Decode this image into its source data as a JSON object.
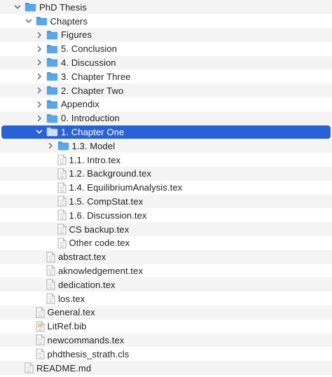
{
  "rows": [
    {
      "label": "PhD Thesis",
      "depth": 0,
      "type": "folder",
      "expander": "expanded",
      "selected": false
    },
    {
      "label": "Chapters",
      "depth": 1,
      "type": "folder",
      "expander": "expanded",
      "selected": false
    },
    {
      "label": "Figures",
      "depth": 2,
      "type": "folder",
      "expander": "collapsed",
      "selected": false
    },
    {
      "label": "5. Conclusion",
      "depth": 2,
      "type": "folder",
      "expander": "collapsed",
      "selected": false
    },
    {
      "label": "4. Discussion",
      "depth": 2,
      "type": "folder",
      "expander": "collapsed",
      "selected": false
    },
    {
      "label": "3. Chapter Three",
      "depth": 2,
      "type": "folder",
      "expander": "collapsed",
      "selected": false
    },
    {
      "label": "2. Chapter Two",
      "depth": 2,
      "type": "folder",
      "expander": "collapsed",
      "selected": false
    },
    {
      "label": "Appendix",
      "depth": 2,
      "type": "folder",
      "expander": "collapsed",
      "selected": false
    },
    {
      "label": "0. Introduction",
      "depth": 2,
      "type": "folder",
      "expander": "collapsed",
      "selected": false
    },
    {
      "label": "1. Chapter One",
      "depth": 2,
      "type": "folder",
      "expander": "expanded",
      "selected": true
    },
    {
      "label": "1.3. Model",
      "depth": 3,
      "type": "folder",
      "expander": "collapsed",
      "selected": false
    },
    {
      "label": "1.1. Intro.tex",
      "depth": 3,
      "type": "tex",
      "expander": "none",
      "selected": false
    },
    {
      "label": "1.2. Background.tex",
      "depth": 3,
      "type": "tex",
      "expander": "none",
      "selected": false
    },
    {
      "label": "1.4. EquilibriumAnalysis.tex",
      "depth": 3,
      "type": "tex",
      "expander": "none",
      "selected": false
    },
    {
      "label": "1.5. CompStat.tex",
      "depth": 3,
      "type": "tex",
      "expander": "none",
      "selected": false
    },
    {
      "label": "1.6. Discussion.tex",
      "depth": 3,
      "type": "tex",
      "expander": "none",
      "selected": false
    },
    {
      "label": "CS backup.tex",
      "depth": 3,
      "type": "tex",
      "expander": "none",
      "selected": false
    },
    {
      "label": "Other code.tex",
      "depth": 3,
      "type": "tex",
      "expander": "none",
      "selected": false
    },
    {
      "label": "abstract.tex",
      "depth": 2,
      "type": "tex",
      "expander": "none",
      "selected": false
    },
    {
      "label": "aknowledgement.tex",
      "depth": 2,
      "type": "tex",
      "expander": "none",
      "selected": false
    },
    {
      "label": "dedication.tex",
      "depth": 2,
      "type": "tex",
      "expander": "none",
      "selected": false
    },
    {
      "label": "los.tex",
      "depth": 2,
      "type": "tex",
      "expander": "none",
      "selected": false
    },
    {
      "label": "General.tex",
      "depth": 1,
      "type": "tex",
      "expander": "none",
      "selected": false
    },
    {
      "label": "LitRef.bib",
      "depth": 1,
      "type": "bib",
      "expander": "none",
      "selected": false
    },
    {
      "label": "newcommands.tex",
      "depth": 1,
      "type": "tex",
      "expander": "none",
      "selected": false
    },
    {
      "label": "phdthesis_strath.cls",
      "depth": 1,
      "type": "cls",
      "expander": "none",
      "selected": false
    },
    {
      "label": "README.md",
      "depth": 0,
      "type": "md",
      "expander": "none",
      "selected": false
    }
  ],
  "colors": {
    "selection": "#2a62d6",
    "stripe": "#f4f4f5",
    "folder": "#5aa7e8",
    "folder_tab": "#4c98dc",
    "chevron": "#6b6b6b"
  },
  "icons": {
    "folder": "folder-icon",
    "tex": "tex-file-icon",
    "bib": "bib-file-icon",
    "cls": "cls-file-icon",
    "md": "md-file-icon",
    "expanded": "chevron-down-icon",
    "collapsed": "chevron-right-icon"
  }
}
